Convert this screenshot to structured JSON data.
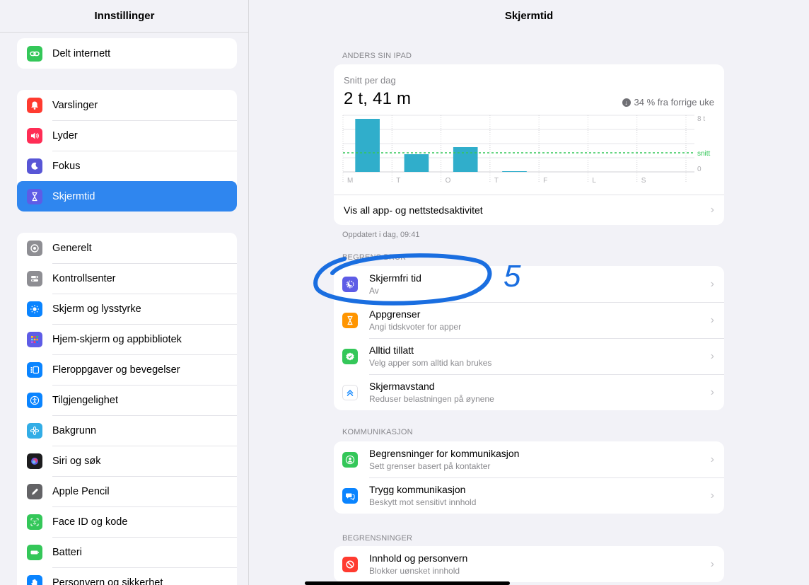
{
  "sidebar": {
    "title": "Innstillinger",
    "groups": [
      [
        {
          "label": "Delt internett",
          "icon": "link-icon",
          "color": "#34c759"
        }
      ],
      [
        {
          "label": "Varslinger",
          "icon": "bell-icon",
          "color": "#ff3b30"
        },
        {
          "label": "Lyder",
          "icon": "speaker-icon",
          "color": "#ff2d55"
        },
        {
          "label": "Fokus",
          "icon": "moon-icon",
          "color": "#5856d6"
        },
        {
          "label": "Skjermtid",
          "icon": "hourglass-icon",
          "color": "#5e5ce6",
          "selected": true
        }
      ],
      [
        {
          "label": "Generelt",
          "icon": "gear-icon",
          "color": "#8e8e93"
        },
        {
          "label": "Kontrollsenter",
          "icon": "switches-icon",
          "color": "#8e8e93"
        },
        {
          "label": "Skjerm og lysstyrke",
          "icon": "sun-icon",
          "color": "#0a84ff"
        },
        {
          "label": "Hjem-skjerm og appbibliotek",
          "icon": "grid-icon",
          "color": "#5e5ce6"
        },
        {
          "label": "Fleroppgaver og bevegelser",
          "icon": "multitask-icon",
          "color": "#0a84ff"
        },
        {
          "label": "Tilgjengelighet",
          "icon": "accessibility-icon",
          "color": "#0a84ff"
        },
        {
          "label": "Bakgrunn",
          "icon": "flower-icon",
          "color": "#32ade6"
        },
        {
          "label": "Siri og søk",
          "icon": "siri-icon",
          "color": "#1c1c1e"
        },
        {
          "label": "Apple Pencil",
          "icon": "pencil-icon",
          "color": "#636366"
        },
        {
          "label": "Face ID og kode",
          "icon": "faceid-icon",
          "color": "#34c759"
        },
        {
          "label": "Batteri",
          "icon": "battery-icon",
          "color": "#34c759"
        },
        {
          "label": "Personvern og sikkerhet",
          "icon": "hand-icon",
          "color": "#0a84ff"
        }
      ]
    ]
  },
  "main": {
    "title": "Skjermtid",
    "device_label": "ANDERS SIN IPAD",
    "summary": {
      "avg_label": "Snitt per dag",
      "avg_value": "2 t, 41 m",
      "change_text": "34 % fra forrige uke",
      "link": "Vis all app- og nettstedsaktivitet"
    },
    "updated": "Oppdatert i dag, 09:41",
    "limits_section_label": "BEGRENS BRUK",
    "limits": [
      {
        "title": "Skjermfri tid",
        "subtitle": "Av",
        "icon": "downtime-icon",
        "color": "#5e5ce6"
      },
      {
        "title": "Appgrenser",
        "subtitle": "Angi tidskvoter for apper",
        "icon": "hourglass-icon",
        "color": "#ff9500"
      },
      {
        "title": "Alltid tillatt",
        "subtitle": "Velg apper som alltid kan brukes",
        "icon": "checkmark-icon",
        "color": "#34c759"
      },
      {
        "title": "Skjermavstand",
        "subtitle": "Reduser belastningen på øynene",
        "icon": "chevrons-up-icon",
        "color": "#ffffff"
      }
    ],
    "comm_section_label": "KOMMUNIKASJON",
    "communication": [
      {
        "title": "Begrensninger for kommunikasjon",
        "subtitle": "Sett grenser basert på kontakter",
        "icon": "person-icon",
        "color": "#34c759"
      },
      {
        "title": "Trygg kommunikasjon",
        "subtitle": "Beskytt mot sensitivt innhold",
        "icon": "chat-icon",
        "color": "#0a84ff"
      }
    ],
    "restrictions_section_label": "BEGRENSNINGER",
    "restrictions": [
      {
        "title": "Innhold og personvern",
        "subtitle": "Blokker uønsket innhold",
        "icon": "prohibited-icon",
        "color": "#ff3b30"
      }
    ],
    "annotation_number": "5"
  },
  "chart_data": {
    "type": "bar",
    "categories": [
      "M",
      "T",
      "O",
      "T",
      "F",
      "L",
      "S"
    ],
    "values": [
      7.5,
      2.5,
      3.5,
      0.1,
      0,
      0,
      0
    ],
    "ylim": [
      0,
      8
    ],
    "y_tick_labels": [
      "8 t",
      "0"
    ],
    "average": 2.7,
    "average_label": "snitt",
    "bar_color": "#30aecb",
    "average_color": "#34c759"
  }
}
